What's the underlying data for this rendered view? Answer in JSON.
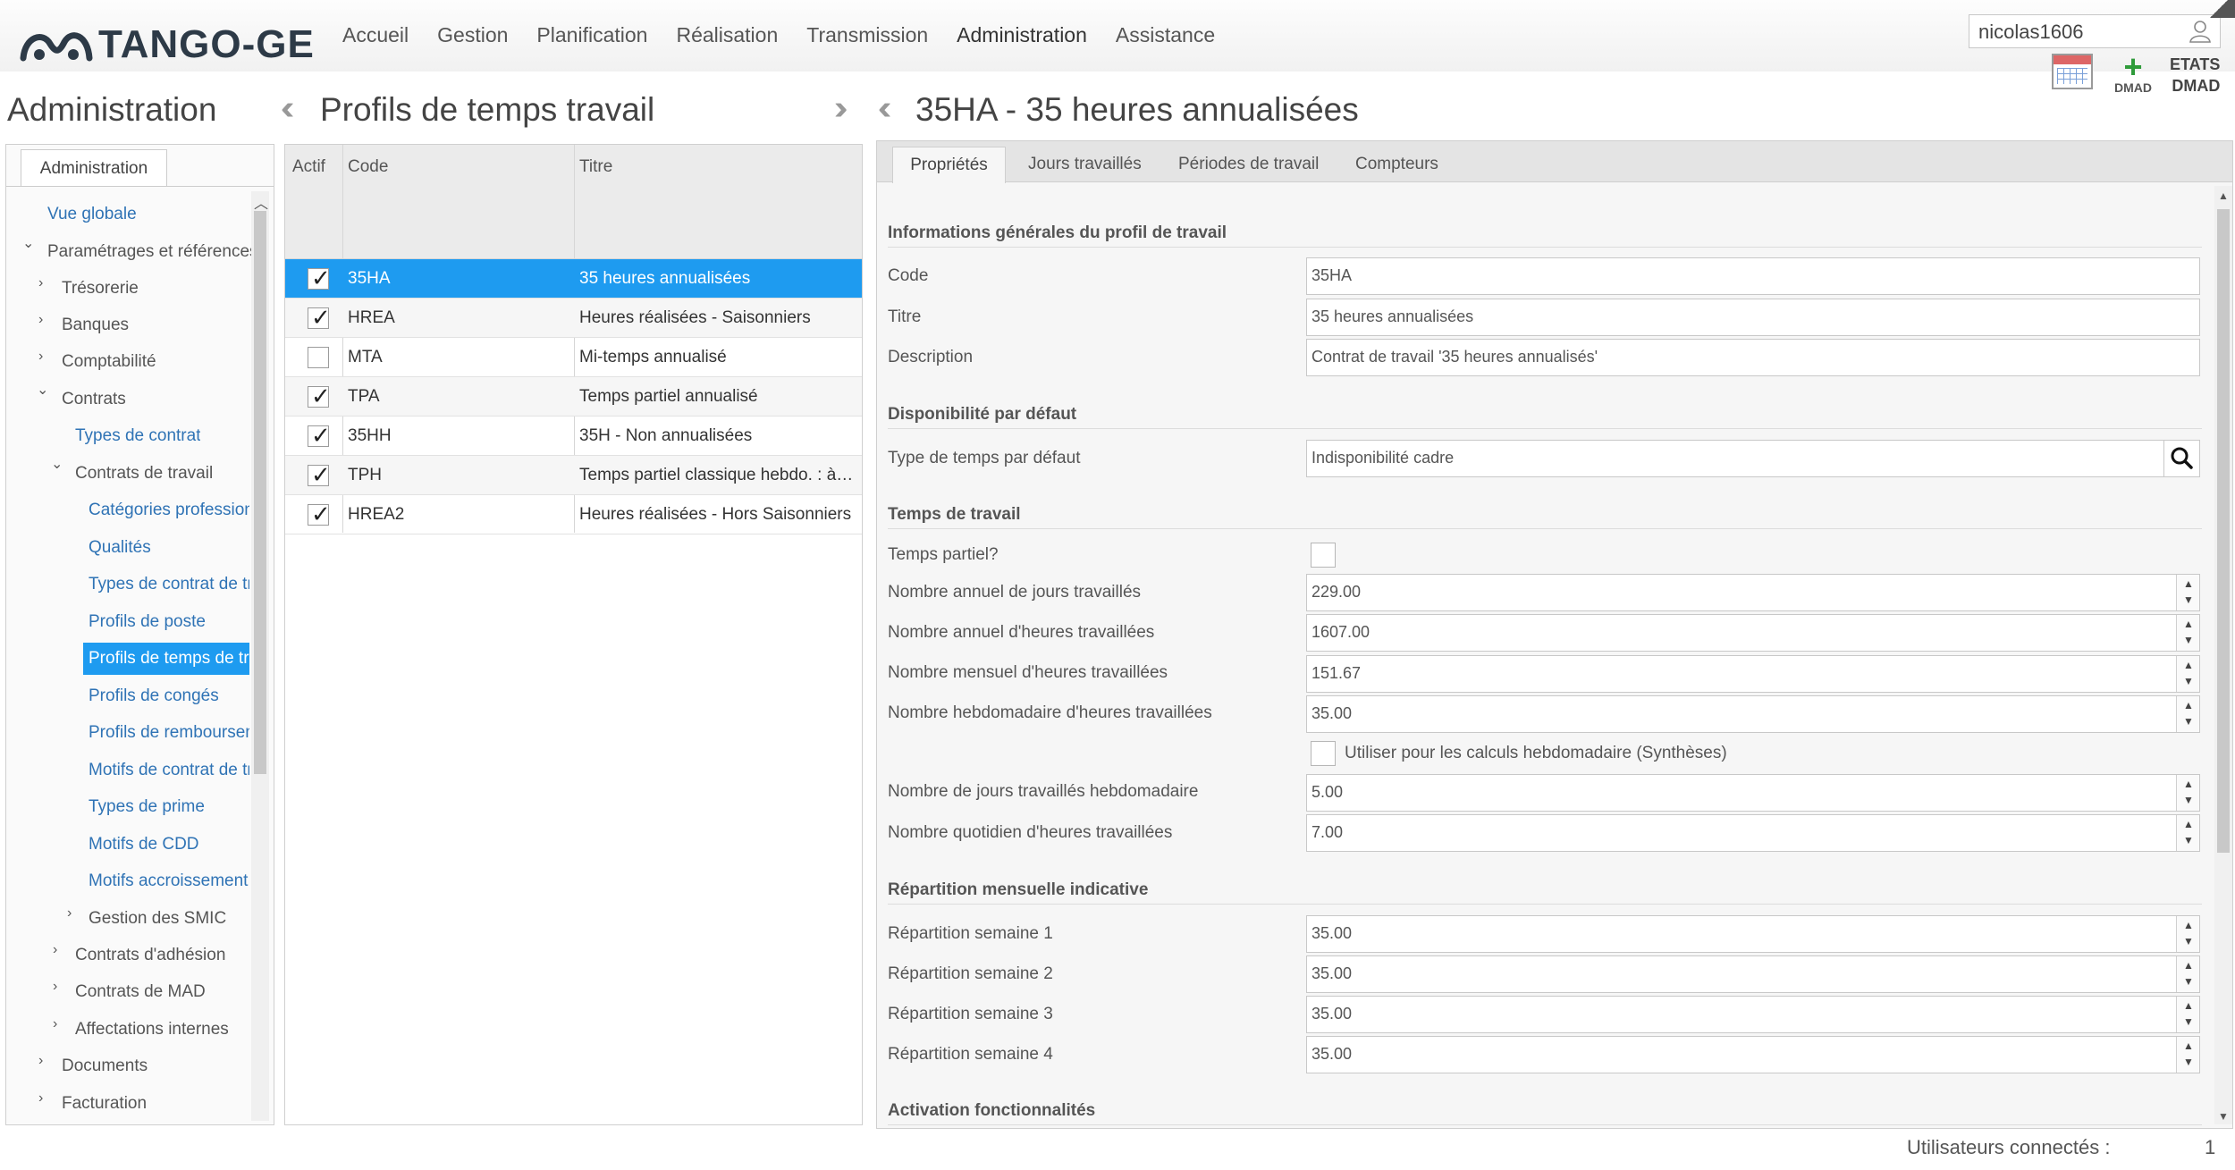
{
  "header": {
    "logo_text": "TANGO-GE",
    "menu": [
      "Accueil",
      "Gestion",
      "Planification",
      "Réalisation",
      "Transmission",
      "Administration",
      "Assistance"
    ],
    "username": "nicolas1606",
    "tools": {
      "dmad_label": "DMAD",
      "etats_label": "ETATS",
      "dmad2_label": "DMAD"
    }
  },
  "panels": {
    "left_title": "Administration",
    "mid_title": "Profils de temps travail",
    "right_title": "35HA - 35 heures annualisées"
  },
  "left": {
    "tab": "Administration",
    "tree": [
      {
        "label": "Vue globale"
      },
      {
        "label": "Paramétrages et références"
      },
      {
        "label": "Trésorerie"
      },
      {
        "label": "Banques"
      },
      {
        "label": "Comptabilité"
      },
      {
        "label": "Contrats"
      },
      {
        "label": "Types de contrat"
      },
      {
        "label": "Contrats de travail"
      },
      {
        "label": "Catégories professionnelles"
      },
      {
        "label": "Qualités"
      },
      {
        "label": "Types de contrat de travail"
      },
      {
        "label": "Profils de poste"
      },
      {
        "label": "Profils de temps de travail"
      },
      {
        "label": "Profils de congés"
      },
      {
        "label": "Profils de remboursement"
      },
      {
        "label": "Motifs de contrat de travail"
      },
      {
        "label": "Types de prime"
      },
      {
        "label": "Motifs de CDD"
      },
      {
        "label": "Motifs accroissement"
      },
      {
        "label": "Gestion des SMIC"
      },
      {
        "label": "Contrats d'adhésion"
      },
      {
        "label": "Contrats de MAD"
      },
      {
        "label": "Affectations internes"
      },
      {
        "label": "Documents"
      },
      {
        "label": "Facturation"
      }
    ]
  },
  "table": {
    "headers": {
      "actif": "Actif",
      "code": "Code",
      "titre": "Titre"
    },
    "rows": [
      {
        "actif": true,
        "code": "35HA",
        "titre": "35 heures annualisées"
      },
      {
        "actif": true,
        "code": "HREA",
        "titre": "Heures réalisées - Saisonniers"
      },
      {
        "actif": false,
        "code": "MTA",
        "titre": "Mi-temps annualisé"
      },
      {
        "actif": true,
        "code": "TPA",
        "titre": "Temps partiel annualisé"
      },
      {
        "actif": true,
        "code": "35HH",
        "titre": "35H - Non annualisées"
      },
      {
        "actif": true,
        "code": "TPH",
        "titre": "Temps partiel classique hebdo. : à p..."
      },
      {
        "actif": true,
        "code": "HREA2",
        "titre": "Heures réalisées - Hors Saisonniers"
      }
    ]
  },
  "detail": {
    "tabs": [
      "Propriétés",
      "Jours travaillés",
      "Périodes de travail",
      "Compteurs"
    ],
    "sections": {
      "general": "Informations générales du profil de travail",
      "dispo": "Disponibilité par défaut",
      "temps": "Temps de travail",
      "repartition": "Répartition mensuelle indicative",
      "activation": "Activation fonctionnalités"
    },
    "fields": {
      "code": {
        "label": "Code",
        "value": "35HA"
      },
      "titre": {
        "label": "Titre",
        "value": "35 heures annualisées"
      },
      "description": {
        "label": "Description",
        "value": "Contrat de travail '35 heures annualisés'"
      },
      "type_temps": {
        "label": "Type de temps par défaut",
        "value": "Indisponibilité cadre"
      },
      "temps_partiel": {
        "label": "Temps partiel?"
      },
      "jours_annuel": {
        "label": "Nombre annuel de jours travaillés",
        "value": "229.00"
      },
      "heures_annuel": {
        "label": "Nombre annuel d'heures travaillées",
        "value": "1607.00"
      },
      "heures_mensuel": {
        "label": "Nombre mensuel d'heures travaillées",
        "value": "151.67"
      },
      "heures_hebdo": {
        "label": "Nombre hebdomadaire d'heures travaillées",
        "value": "35.00"
      },
      "utiliser_calculs": {
        "label": "Utiliser pour les calculs hebdomadaire (Synthèses)"
      },
      "jours_hebdo": {
        "label": "Nombre de jours travaillés hebdomadaire",
        "value": "5.00"
      },
      "heures_quotidien": {
        "label": "Nombre quotidien d'heures travaillées",
        "value": "7.00"
      },
      "semaine1": {
        "label": "Répartition semaine 1",
        "value": "35.00"
      },
      "semaine2": {
        "label": "Répartition semaine 2",
        "value": "35.00"
      },
      "semaine3": {
        "label": "Répartition semaine 3",
        "value": "35.00"
      },
      "semaine4": {
        "label": "Répartition semaine 4",
        "value": "35.00"
      }
    }
  },
  "status": {
    "label": "Utilisateurs connectés :",
    "count": "1"
  },
  "colors": {
    "accent": "#1e9bf0",
    "link": "#2f73b5",
    "logo": "#2d3a47"
  }
}
